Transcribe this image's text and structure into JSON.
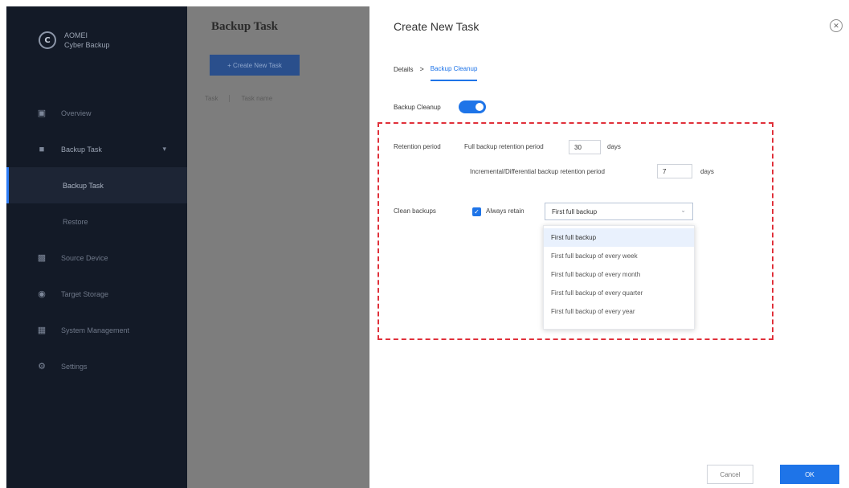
{
  "sidebar": {
    "brand_line1": "AOMEI",
    "brand_line2": "Cyber Backup",
    "items": [
      {
        "label": "Overview",
        "icon": "home-icon"
      },
      {
        "label": "Backup Task",
        "icon": "folder-icon"
      },
      {
        "label": "Backup Task",
        "icon": ""
      },
      {
        "label": "Restore",
        "icon": ""
      },
      {
        "label": "Source Device",
        "icon": "device-icon"
      },
      {
        "label": "Target Storage",
        "icon": "storage-icon"
      },
      {
        "label": "System Management",
        "icon": "settings-icon"
      },
      {
        "label": "Settings",
        "icon": "gear-icon"
      }
    ]
  },
  "page": {
    "title": "Backup Task",
    "create_button": "+ Create New Task",
    "columns": [
      "Task",
      "Task name"
    ]
  },
  "drawer": {
    "title": "Create New Task",
    "tabs": [
      "Details",
      "Backup Cleanup"
    ],
    "tab_separator": ">",
    "backup_cleanup_label": "Backup Cleanup",
    "retention_period_label": "Retention period",
    "full_backup_label": "Full backup retention period",
    "full_backup_value": "30",
    "full_backup_unit": "days",
    "incremental_label": "Incremental/Differential backup retention period",
    "incremental_value": "7",
    "incremental_unit": "days",
    "clean_backups_label": "Clean backups",
    "always_retain_label": "Always retain",
    "select_value": "First full backup",
    "options": [
      "First full backup",
      "First full backup of every week",
      "First full backup of every month",
      "First full backup of every quarter",
      "First full backup of every year"
    ],
    "cancel_label": "Cancel",
    "ok_label": "OK"
  },
  "colors": {
    "accent": "#1e74e8",
    "highlight_border": "#e0303a",
    "sidebar_bg": "#131a27"
  }
}
